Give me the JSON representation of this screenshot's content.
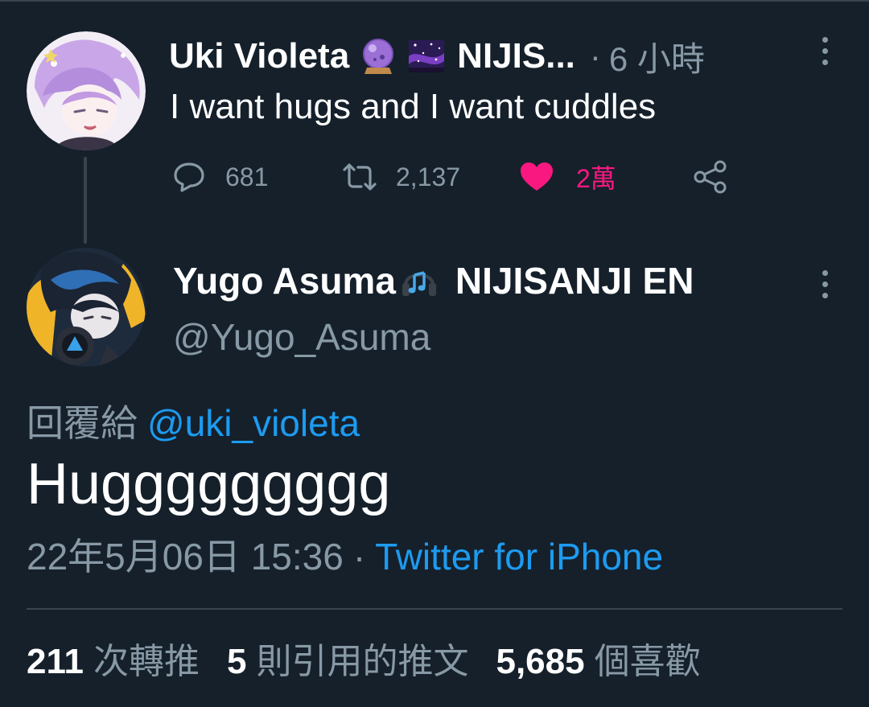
{
  "parent_tweet": {
    "display_name": "Uki Violeta",
    "name_suffix": "NIJIS...",
    "meta_separator": "·",
    "time_ago": "6 小時",
    "text": "I want hugs and I want cuddles",
    "actions": {
      "reply_count": "681",
      "retweet_count": "2,137",
      "like_count": "2萬"
    },
    "badges": [
      "crystal-ball-icon",
      "night-sky-icon"
    ]
  },
  "reply_tweet": {
    "display_name": "Yugo Asuma",
    "name_suffix": "NIJISANJI EN",
    "handle": "@Yugo_Asuma",
    "badge": "headphone-icon",
    "reply_label": "回覆給",
    "reply_to": "@uki_violeta",
    "text": "Huggggggggg",
    "timestamp": "22年5月06日 15:36",
    "separator": "·",
    "source": "Twitter for iPhone"
  },
  "stats": {
    "retweets_num": "211",
    "retweets_label": "次轉推",
    "quotes_num": "5",
    "quotes_label": "則引用的推文",
    "likes_num": "5,685",
    "likes_label": "個喜歡"
  },
  "colors": {
    "background": "#15202b",
    "muted": "#8899a6",
    "link": "#1d9bf0",
    "like": "#f91880",
    "divider": "#38444d"
  }
}
